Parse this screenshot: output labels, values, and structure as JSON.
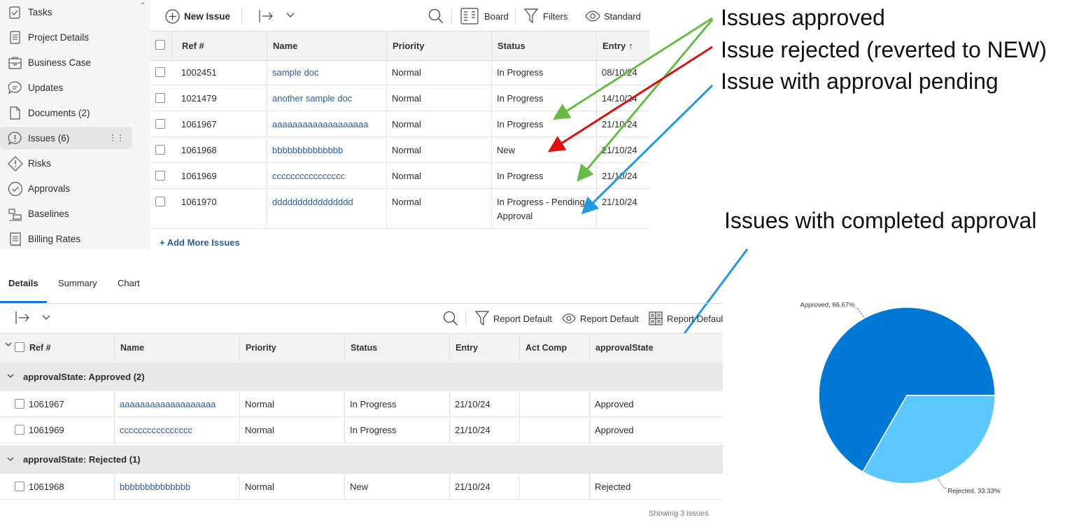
{
  "sidebar": {
    "items": [
      {
        "label": "Tasks",
        "icon": "checkbox-clipboard-icon"
      },
      {
        "label": "Project Details",
        "icon": "document-lines-icon"
      },
      {
        "label": "Business Case",
        "icon": "briefcase-icon"
      },
      {
        "label": "Updates",
        "icon": "chat-bubble-icon"
      },
      {
        "label": "Documents (2)",
        "icon": "document-icon"
      },
      {
        "label": "Issues (6)",
        "icon": "issue-bubble-icon"
      },
      {
        "label": "Risks",
        "icon": "warning-diamond-icon"
      },
      {
        "label": "Approvals",
        "icon": "check-circle-icon"
      },
      {
        "label": "Baselines",
        "icon": "baseline-icon"
      },
      {
        "label": "Billing Rates",
        "icon": "receipt-icon"
      }
    ]
  },
  "toolbar": {
    "new_issue": "New Issue",
    "board": "Board",
    "filters": "Filters",
    "standard": "Standard"
  },
  "issues_table": {
    "columns": [
      "Ref #",
      "Name",
      "Priority",
      "Status",
      "Entry ↑"
    ],
    "rows": [
      {
        "ref": "1002451",
        "name": "sample doc",
        "priority": "Normal",
        "status": "In Progress",
        "entry": "08/10/24"
      },
      {
        "ref": "1021479",
        "name": "another sample doc",
        "priority": "Normal",
        "status": "In Progress",
        "entry": "14/10/24"
      },
      {
        "ref": "1061967",
        "name": "aaaaaaaaaaaaaaaaaaa",
        "priority": "Normal",
        "status": "In Progress",
        "entry": "21/10/24"
      },
      {
        "ref": "1061968",
        "name": "bbbbbbbbbbbbbb",
        "priority": "Normal",
        "status": "New",
        "entry": "21/10/24"
      },
      {
        "ref": "1061969",
        "name": "cccccccccccccccc",
        "priority": "Normal",
        "status": "In Progress",
        "entry": "21/10/24"
      },
      {
        "ref": "1061970",
        "name": "dddddddddddddddd",
        "priority": "Normal",
        "status_line1": "In Progress - Pending",
        "status_line2": "Approval",
        "entry": "21/10/24"
      }
    ],
    "add_more": "+ Add More Issues"
  },
  "annotations": {
    "approved": "Issues approved",
    "rejected": "Issue rejected (reverted to NEW)",
    "pending": "Issue with approval pending",
    "completed": "Issues with completed approval"
  },
  "colors": {
    "approved_arrow": "#66bb44",
    "rejected_arrow": "#dd1111",
    "pending_arrow": "#2299dd",
    "pie_approved": "#0078d4",
    "pie_rejected": "#5cc8ff",
    "tab_accent": "#1473e6"
  },
  "report": {
    "tabs": [
      "Details",
      "Summary",
      "Chart"
    ],
    "toolbar": {
      "filter": "Report Default",
      "view": "Report Default",
      "grouping": "Report Default"
    },
    "columns": [
      "Ref #",
      "Name",
      "Priority",
      "Status",
      "Entry",
      "Act Comp",
      "approvalState"
    ],
    "groups": [
      {
        "label": "approvalState: Approved (2)",
        "rows": [
          {
            "ref": "1061967",
            "name": "aaaaaaaaaaaaaaaaaaa",
            "priority": "Normal",
            "status": "In Progress",
            "entry": "21/10/24",
            "act_comp": "",
            "approval": "Approved"
          },
          {
            "ref": "1061969",
            "name": "cccccccccccccccc",
            "priority": "Normal",
            "status": "In Progress",
            "entry": "21/10/24",
            "act_comp": "",
            "approval": "Approved"
          }
        ]
      },
      {
        "label": "approvalState: Rejected (1)",
        "rows": [
          {
            "ref": "1061968",
            "name": "bbbbbbbbbbbbbb",
            "priority": "Normal",
            "status": "New",
            "entry": "21/10/24",
            "act_comp": "",
            "approval": "Rejected"
          }
        ]
      }
    ],
    "footer": "Showing 3 issues"
  },
  "chart_data": {
    "type": "pie",
    "categories": [
      "Approved",
      "Rejected"
    ],
    "values": [
      66.67,
      33.33
    ],
    "labels": [
      "Approved, 66.67%",
      "Rejected, 33.33%"
    ],
    "colors": [
      "#0078d4",
      "#5cc8ff"
    ]
  }
}
